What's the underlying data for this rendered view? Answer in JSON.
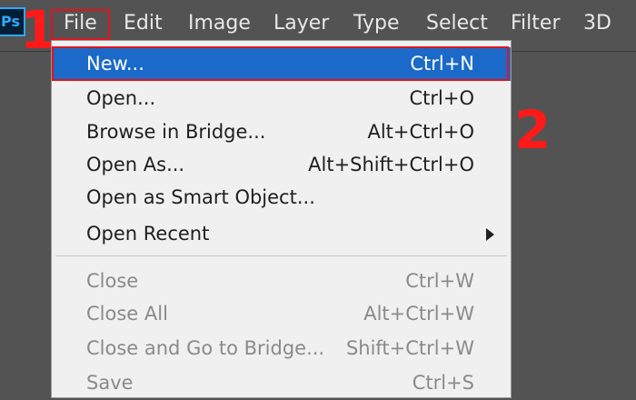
{
  "app": {
    "logo": "Ps"
  },
  "menubar": {
    "items": [
      {
        "label": "File"
      },
      {
        "label": "Edit"
      },
      {
        "label": "Image"
      },
      {
        "label": "Layer"
      },
      {
        "label": "Type"
      },
      {
        "label": "Select"
      },
      {
        "label": "Filter"
      },
      {
        "label": "3D"
      }
    ]
  },
  "annotations": {
    "step1": "1",
    "step2": "2"
  },
  "file_menu": {
    "items": [
      {
        "label": "New...",
        "shortcut": "Ctrl+N",
        "enabled": true,
        "highlighted": true
      },
      {
        "label": "Open...",
        "shortcut": "Ctrl+O",
        "enabled": true
      },
      {
        "label": "Browse in Bridge...",
        "shortcut": "Alt+Ctrl+O",
        "enabled": true
      },
      {
        "label": "Open As...",
        "shortcut": "Alt+Shift+Ctrl+O",
        "enabled": true
      },
      {
        "label": "Open as Smart Object...",
        "shortcut": "",
        "enabled": true
      },
      {
        "label": "Open Recent",
        "shortcut": "",
        "enabled": true,
        "submenu": true
      },
      {
        "label": "Close",
        "shortcut": "Ctrl+W",
        "enabled": false
      },
      {
        "label": "Close All",
        "shortcut": "Alt+Ctrl+W",
        "enabled": false
      },
      {
        "label": "Close and Go to Bridge...",
        "shortcut": "Shift+Ctrl+W",
        "enabled": false
      },
      {
        "label": "Save",
        "shortcut": "Ctrl+S",
        "enabled": false
      }
    ]
  },
  "colors": {
    "background": "#535353",
    "menu_bg": "#f0f0f0",
    "highlight": "#1b6ac9",
    "annotation_red": "#e0141c",
    "ps_blue": "#31a8ff"
  },
  "icons": {
    "logo": "photoshop-logo-icon",
    "submenu": "submenu-arrow-icon"
  }
}
